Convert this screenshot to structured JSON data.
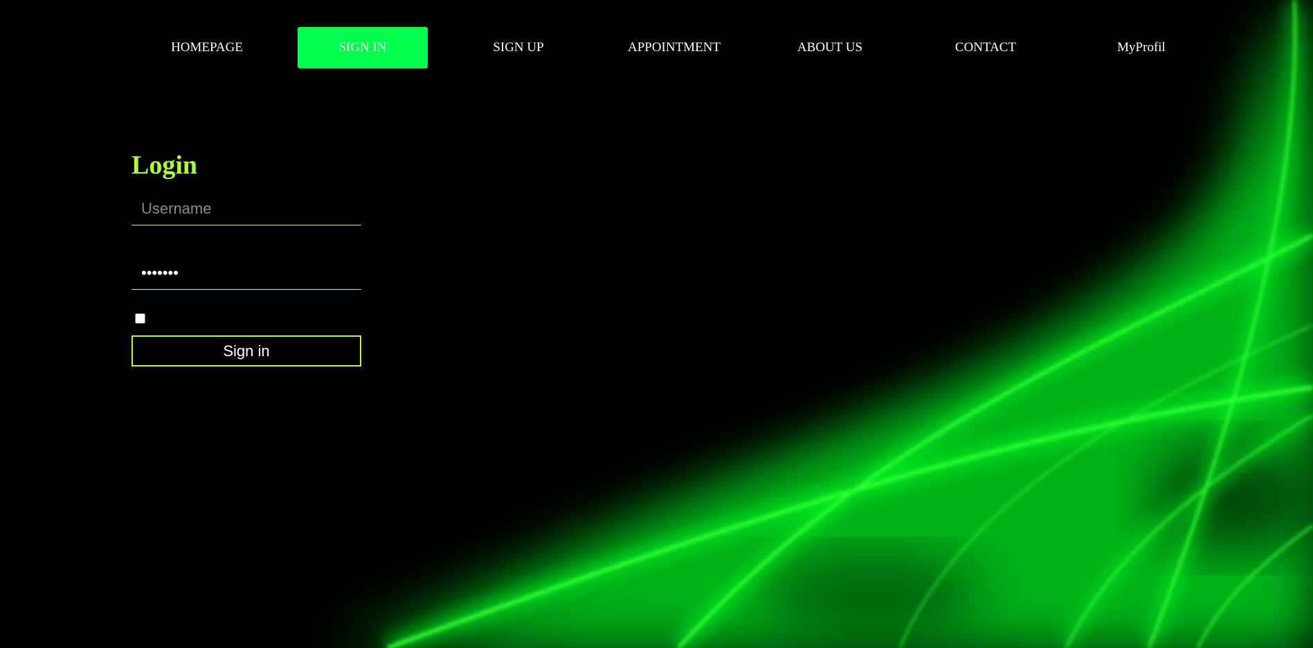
{
  "nav": {
    "items": [
      {
        "label": "HOMEPAGE",
        "active": false
      },
      {
        "label": "SIGN IN",
        "active": true
      },
      {
        "label": "SIGN UP",
        "active": false
      },
      {
        "label": "APPOINTMENT",
        "active": false
      },
      {
        "label": "ABOUT US",
        "active": false
      },
      {
        "label": "CONTACT",
        "active": false
      },
      {
        "label": "MyProfil",
        "active": false
      }
    ]
  },
  "login": {
    "title": "Login",
    "username_placeholder": "Username",
    "username_value": "",
    "password_value": "•••••••",
    "remember_checked": false,
    "submit_label": "Sign in"
  },
  "colors": {
    "background": "#000000",
    "accent": "#adff2f",
    "active_nav": "#00ff4c",
    "glow": "#00ff22"
  }
}
